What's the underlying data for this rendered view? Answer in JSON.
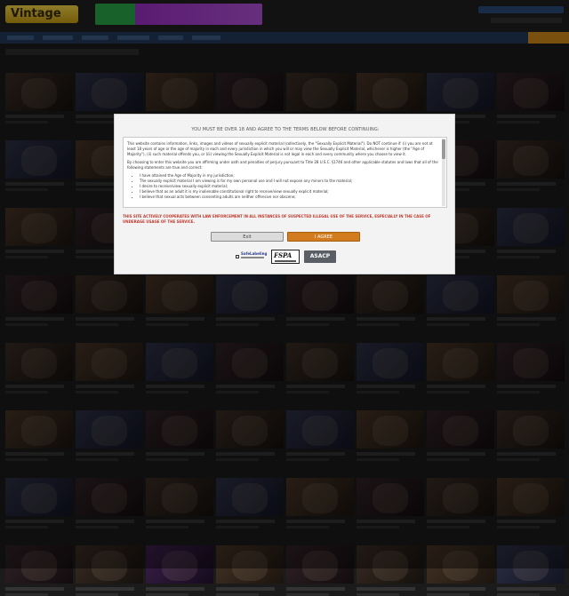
{
  "site": {
    "logo_text": "Vintage",
    "banner_colors": {
      "left": "#2aa84a",
      "right": "#9b2fc4"
    },
    "nav_accent_color": "#d38a1a"
  },
  "age_gate": {
    "title": "YOU MUST BE OVER 18 AND AGREE TO THE TERMS BELOW BEFORE CONTINUING:",
    "paragraph1": "This website contains information, links, images and videos of sexually explicit material (collectively, the \"Sexually Explicit Material\"). Do NOT continue if: (i) you are not at least 18 years of age or the age of majority in each and every jurisdiction in which you will or may view the Sexually Explicit Material, whichever is higher (the \"Age of Majority\"), (ii) such material offends you, or (iii) viewing the Sexually Explicit Material is not legal in each and every community where you choose to view it.",
    "paragraph2": "By choosing to enter this website you are affirming under oath and penalties of perjury pursuant to Title 28 U.S.C. §1746 and other applicable statutes and laws that all of the following statements are true and correct:",
    "statements": [
      "I have attained the Age of Majority in my jurisdiction;",
      "The sexually explicit material I am viewing is for my own personal use and I will not expose any minors to the material;",
      "I desire to receive/view sexually explicit material;",
      "I believe that as an adult it is my inalienable constitutional right to receive/view sexually explicit material;",
      "I believe that sexual acts between consenting adults are neither offensive nor obscene;"
    ],
    "warning": "THIS SITE ACTIVELY COOPERATES WITH LAW ENFORCEMENT IN ALL INSTANCES OF SUSPECTED ILLEGAL USE OF THE SERVICE, ESPECIALLY IN THE CASE OF UNDERAGE USAGE OF THE SERVICE.",
    "exit_label": "Exit",
    "agree_label": "I AGREE",
    "agree_color": "#d27b1f",
    "warning_color": "#c0392b",
    "badges": {
      "safelabeling": "SafeLabeling",
      "fspa": "FSPA",
      "asacp": "ASACP"
    }
  }
}
